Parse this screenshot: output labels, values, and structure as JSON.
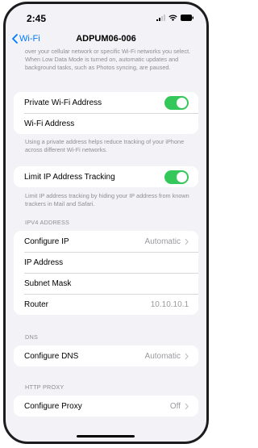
{
  "status": {
    "time": "2:45"
  },
  "nav": {
    "back_label": "Wi-Fi",
    "title": "ADPUM06-006"
  },
  "low_data_note": "over your cellular network or specific Wi-Fi networks you select. When Low Data Mode is turned on, automatic updates and background tasks, such as Photos syncing, are paused.",
  "privacy": {
    "private_address_label": "Private Wi-Fi Address",
    "private_address_on": true,
    "wifi_address_label": "Wi-Fi Address",
    "note": "Using a private address helps reduce tracking of your iPhone across different Wi-Fi networks."
  },
  "tracking": {
    "label": "Limit IP Address Tracking",
    "on": true,
    "note": "Limit IP address tracking by hiding your IP address from known trackers in Mail and Safari."
  },
  "ipv4": {
    "header": "IPV4 ADDRESS",
    "configure_label": "Configure IP",
    "configure_value": "Automatic",
    "ip_label": "IP Address",
    "subnet_label": "Subnet Mask",
    "router_label": "Router",
    "router_value": "10.10.10.1"
  },
  "dns": {
    "header": "DNS",
    "label": "Configure DNS",
    "value": "Automatic"
  },
  "proxy": {
    "header": "HTTP PROXY",
    "label": "Configure Proxy",
    "value": "Off"
  },
  "colors": {
    "accent": "#007aff",
    "toggle_on": "#34c759",
    "background": "#f2f2f7"
  }
}
